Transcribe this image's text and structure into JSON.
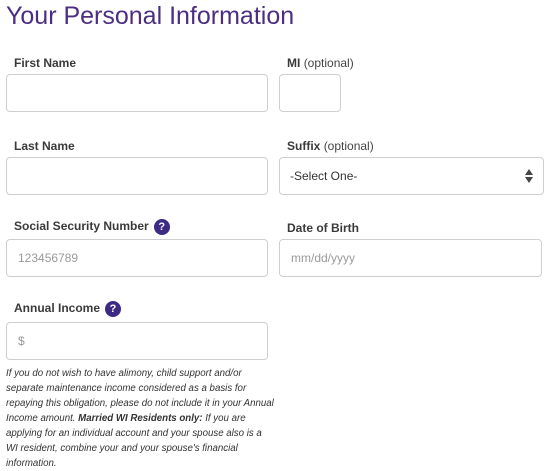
{
  "page_title": "Your Personal Information",
  "first_name": {
    "label": "First Name",
    "value": "",
    "placeholder": ""
  },
  "mi": {
    "label": "MI",
    "optional": "(optional)",
    "value": "",
    "placeholder": ""
  },
  "last_name": {
    "label": "Last Name",
    "value": "",
    "placeholder": ""
  },
  "suffix": {
    "label": "Suffix",
    "optional": "(optional)",
    "selected": "-Select One-"
  },
  "ssn": {
    "label": "Social Security Number",
    "help": "?",
    "value": "",
    "placeholder": "123456789"
  },
  "dob": {
    "label": "Date of Birth",
    "value": "",
    "placeholder": "mm/dd/yyyy"
  },
  "income": {
    "label": "Annual Income",
    "help": "?",
    "value": "",
    "placeholder": "$"
  },
  "note": {
    "text1": "If you do not wish to have alimony, child support and/or separate maintenance income considered as a basis for repaying this obligation, please do not include it in your Annual Income amount.",
    "bold": "Married WI Residents only:",
    "text2": "If you are applying for an individual account and your spouse also is a WI resident, combine your and your spouse's financial information."
  },
  "colors": {
    "title": "#4b2e83",
    "help_badge": "#3d2a84",
    "border": "#cfcfcf"
  }
}
